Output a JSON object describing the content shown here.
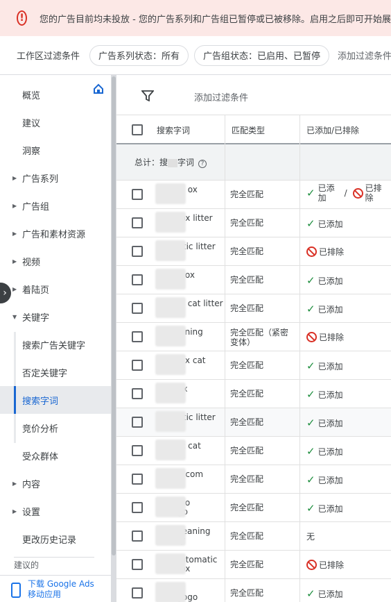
{
  "banner": {
    "icon": "alert-icon",
    "text": "您的广告目前均未投放 - 您的广告系列和广告组已暂停或已被移除。启用之后即可开始展"
  },
  "filter_bar": {
    "label": "工作区过滤条件",
    "chips": [
      "广告系列状态：所有",
      "广告组状态：已启用、已暂停"
    ],
    "add": "添加过滤条件"
  },
  "sidebar": {
    "items": [
      {
        "label": "概览",
        "arrow": false
      },
      {
        "label": "建议",
        "arrow": false
      },
      {
        "label": "洞察",
        "arrow": false
      },
      {
        "label": "广告系列",
        "arrow": true
      },
      {
        "label": "广告组",
        "arrow": true
      },
      {
        "label": "广告和素材资源",
        "arrow": true
      },
      {
        "label": "视频",
        "arrow": true
      },
      {
        "label": "着陆页",
        "arrow": true
      },
      {
        "label": "关键字",
        "arrow": true,
        "expanded": true
      },
      {
        "label": "搜索广告关键字",
        "sub": true
      },
      {
        "label": "否定关键字",
        "sub": true
      },
      {
        "label": "搜索字词",
        "sub": true,
        "active": true
      },
      {
        "label": "竞价分析",
        "sub": true
      },
      {
        "label": "受众群体",
        "arrow": false
      },
      {
        "label": "内容",
        "arrow": true
      },
      {
        "label": "设置",
        "arrow": true
      },
      {
        "label": "更改历史记录",
        "arrow": false
      }
    ],
    "suggest": "建议的",
    "download": [
      "下载 Google Ads",
      "移动应用"
    ]
  },
  "main": {
    "add_filter": "添加过滤条件",
    "headers": {
      "term": "搜索字词",
      "match": "匹配类型",
      "status": "已添加/已排除"
    },
    "total_label": "总计：搜",
    "total_label2": "字词",
    "help": "?",
    "rows": [
      {
        "term": "c          ox",
        "match": "完全匹配",
        "status": "both",
        "added": "已添\n加",
        "sep": "/",
        "excluded": "已排\n除"
      },
      {
        "term": "         ox litter",
        "match": "完全匹配",
        "status": "added",
        "label": "已添加"
      },
      {
        "term": "        atic litter\nbo",
        "match": "完全匹配",
        "status": "excluded",
        "label": "已排除"
      },
      {
        "term": "ch       ox",
        "match": "完全匹配",
        "status": "added",
        "label": "已添加"
      },
      {
        "term": "ch        cat litter\nbo",
        "match": "完全匹配",
        "status": "added",
        "label": "已添加"
      },
      {
        "term": "s         ning\nli",
        "match": "完全匹配（紧密\n变体）",
        "status": "excluded",
        "label": "已排除"
      },
      {
        "term": "c         x cat\n       ox",
        "match": "完全匹配",
        "status": "added",
        "label": "已添加"
      },
      {
        "term": "        ox",
        "match": "完全匹配",
        "status": "added",
        "label": "已添加"
      },
      {
        "term": "        atic litter",
        "match": "完全匹配",
        "status": "added",
        "label": "已添加",
        "alt": true
      },
      {
        "term": "       tic cat\n       ox",
        "match": "完全匹配",
        "status": "added",
        "label": "已添加"
      },
      {
        "term": "        x com",
        "match": "完全匹配",
        "status": "added",
        "label": "已添加"
      },
      {
        "term": "c       bo\ni       go",
        "match": "完全匹配",
        "status": "added",
        "label": "已添加"
      },
      {
        "term": "       cleaning\n       ay",
        "match": "完全匹配",
        "status": "none",
        "label": "无"
      },
      {
        "term": "       automatic\n       box",
        "match": "完全匹配",
        "status": "excluded",
        "label": "已排除"
      },
      {
        "term": "       ox\nindiegogo",
        "match": "完全匹配",
        "status": "added",
        "label": "已添加"
      }
    ]
  },
  "colors": {
    "accent": "#1967d2",
    "success": "#1e8e3e",
    "danger": "#d93025",
    "banner_bg": "#fce8e6"
  }
}
